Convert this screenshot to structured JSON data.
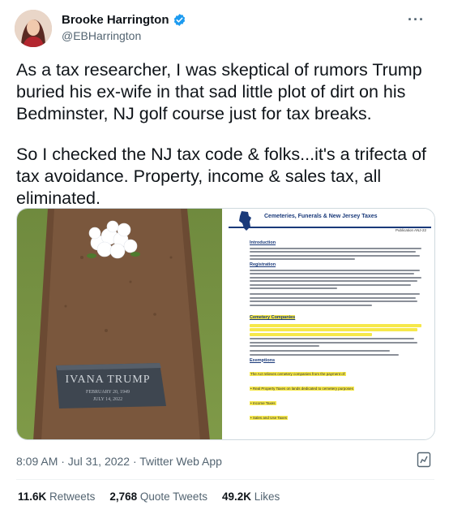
{
  "author": {
    "display_name": "Brooke Harrington",
    "handle": "@EBHarrington",
    "verified_icon": "verified-badge-icon",
    "verified_color": "#1d9bf0"
  },
  "more_label": "···",
  "tweet": {
    "paragraph_1": "As a tax researcher, I was skeptical of rumors Trump buried his ex-wife in that sad little plot of dirt on his Bedminster, NJ golf course just for tax breaks.",
    "paragraph_2": "So I checked the NJ tax code & folks...it's a trifecta of tax avoidance. Property, income & sales tax, all eliminated."
  },
  "media": {
    "photo": {
      "gravestone_name": "IVANA TRUMP",
      "gravestone_born": "FEBRUARY 20, 1949",
      "gravestone_died": "JULY 14, 2022"
    },
    "document": {
      "title": "Cemeteries, Funerals & New Jersey Taxes",
      "publication": "Publication ANJ-22",
      "section_intro": "Introduction",
      "section_registration": "Registration",
      "section_cemetery": "Cemetery Companies",
      "section_exemptions": "Exemptions",
      "exempt_intro": "The Act relieves cemetery companies from the payment of:",
      "exempt_1": "• Real Property Taxes on lands dedicated to cemetery purposes",
      "exempt_2": "• Income Taxes",
      "exempt_3": "• Sales and Use Taxes",
      "highlight_color": "#f6e84a"
    }
  },
  "meta": {
    "timestamp": "8:09 AM · Jul 31, 2022 · Twitter Web App",
    "analytics_icon": "analytics-icon"
  },
  "stats": {
    "retweets_count": "11.6K",
    "retweets_label": "Retweets",
    "quotes_count": "2,768",
    "quotes_label": "Quote Tweets",
    "likes_count": "49.2K",
    "likes_label": "Likes"
  }
}
